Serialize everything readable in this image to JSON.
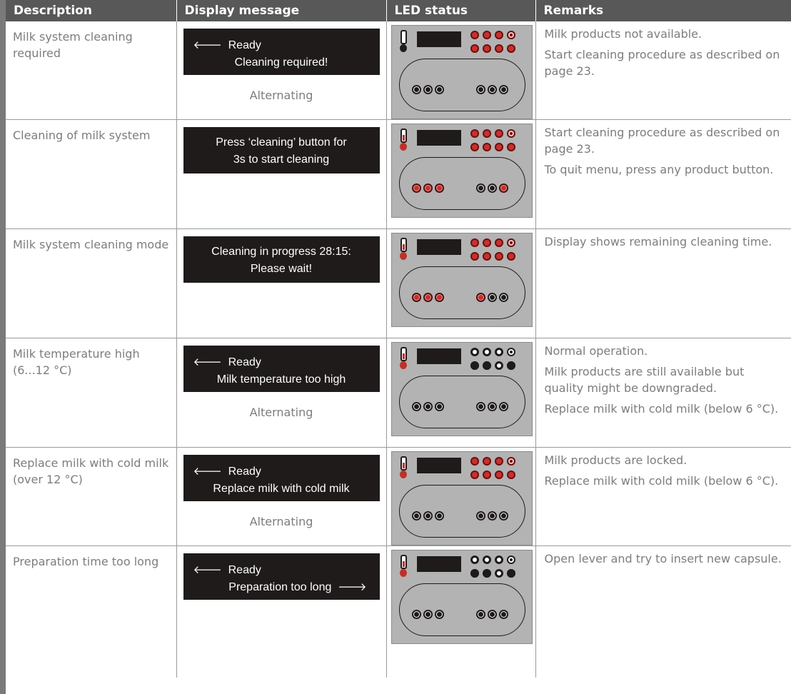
{
  "headers": {
    "description": "Description",
    "display": "Display message",
    "led": "LED status",
    "remarks": "Remarks"
  },
  "rows": [
    {
      "description": "Milk system cleaning required",
      "lcd": {
        "line1": "Ready",
        "line2": "Cleaning required!"
      },
      "alternating": "Alternating",
      "remarks": [
        "Milk products not available.",
        "Start cleaning procedure as described on page 23."
      ],
      "led_state": {
        "therm": "off",
        "top": [
          "red",
          "red",
          "red",
          "ring-red"
        ],
        "mid": [
          "red",
          "red",
          "red",
          "red"
        ],
        "oval_left": [
          "off",
          "off",
          "off"
        ],
        "oval_right": [
          "off",
          "off",
          "off"
        ]
      }
    },
    {
      "description": "Cleaning of milk system",
      "lcd": {
        "line1": "Press ‘cleaning’ button for",
        "line2": "3s to start cleaning"
      },
      "alternating": "",
      "remarks": [
        "Start cleaning procedure as described on page 23.",
        "To quit menu, press any product button."
      ],
      "led_state": {
        "therm": "on",
        "top": [
          "red",
          "red",
          "red",
          "ring-red"
        ],
        "mid": [
          "red",
          "red",
          "red",
          "red"
        ],
        "oval_left": [
          "red",
          "red",
          "red"
        ],
        "oval_right": [
          "off",
          "off",
          "red"
        ]
      }
    },
    {
      "description": "Milk system cleaning mode",
      "lcd": {
        "line1": "Cleaning in progress 28:15:",
        "line2": "Please wait!"
      },
      "alternating": "",
      "remarks": [
        "Display shows remaining cleaning time."
      ],
      "led_state": {
        "therm": "on",
        "top": [
          "red",
          "red",
          "red",
          "ring-red"
        ],
        "mid": [
          "red",
          "red",
          "red",
          "red"
        ],
        "oval_left": [
          "red",
          "red",
          "red"
        ],
        "oval_right": [
          "red",
          "off",
          "off"
        ]
      }
    },
    {
      "description": "Milk temperature high (6...12 °C)",
      "lcd": {
        "line1": "Ready",
        "line2": "Milk temperature too high"
      },
      "alternating": "Alternating",
      "remarks": [
        "Normal operation.",
        "Milk products are still available but quality might be downgraded.",
        "Replace milk with cold milk (below 6 °C)."
      ],
      "led_state": {
        "therm": "on",
        "top": [
          "white",
          "white",
          "white",
          "ring"
        ],
        "mid": [
          "off",
          "off",
          "white",
          "off"
        ],
        "oval_left": [
          "off",
          "off",
          "off"
        ],
        "oval_right": [
          "off",
          "off",
          "off"
        ]
      }
    },
    {
      "description": "Replace milk with cold milk (over 12 °C)",
      "lcd": {
        "line1": "Ready",
        "line2": "Replace milk with cold milk"
      },
      "alternating": "Alternating",
      "remarks": [
        "Milk products are locked.",
        "Replace milk with cold milk (below 6 °C)."
      ],
      "led_state": {
        "therm": "on",
        "top": [
          "red",
          "red",
          "red",
          "ring-red"
        ],
        "mid": [
          "red",
          "red",
          "red",
          "red"
        ],
        "oval_left": [
          "off",
          "off",
          "off"
        ],
        "oval_right": [
          "off",
          "off",
          "off"
        ]
      }
    },
    {
      "description": "Preparation time too long",
      "lcd": {
        "line1": "Ready",
        "line2": "Preparation too long"
      },
      "alternating": "",
      "remarks": [
        "Open lever and try to insert new capsule."
      ],
      "led_state": {
        "therm": "on",
        "top": [
          "white",
          "white",
          "white",
          "ring"
        ],
        "mid": [
          "off",
          "off",
          "white",
          "off"
        ],
        "oval_left": [
          "off",
          "off",
          "off"
        ],
        "oval_right": [
          "off",
          "off",
          "off"
        ]
      }
    }
  ],
  "colors": {
    "header_bg": "#585858",
    "lcd_bg": "#1e1b1a",
    "panel_bg": "#b3b3b3",
    "led_red": "#c9302c",
    "text": "#7d7d7d"
  }
}
